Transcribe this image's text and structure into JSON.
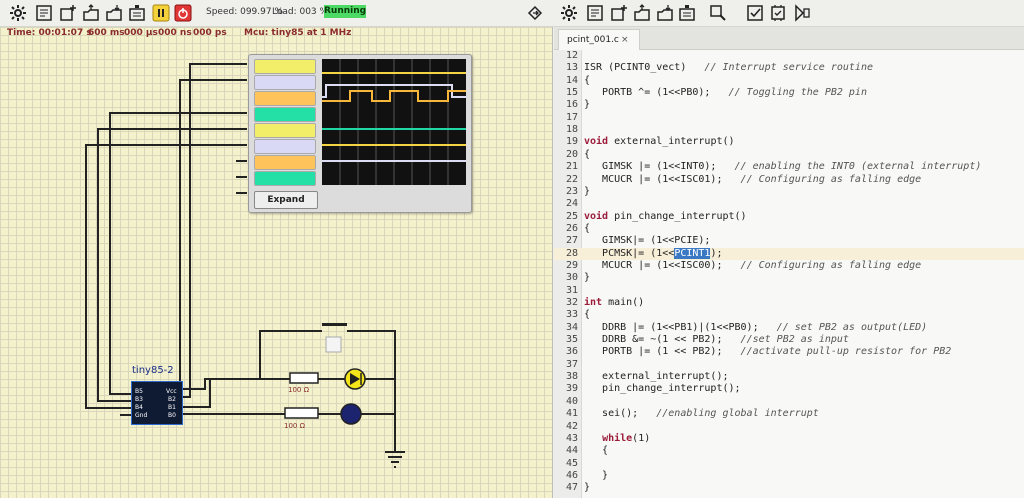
{
  "toolbar": {
    "left_icons": [
      "gear-icon",
      "list-check-icon",
      "new-file-icon",
      "open-file-icon",
      "upload-icon",
      "save-icon",
      "pause-icon",
      "power-icon"
    ],
    "speed": "Speed: 099.97 %",
    "load": "Load: 003 %",
    "status": "Running",
    "right_icons": [
      "diamond-arrow-icon",
      "gear-icon",
      "list-check-icon",
      "new-file-icon",
      "open-file-icon",
      "upload-icon",
      "save-icon",
      "search-icon",
      "checkbox-icon",
      "compile-icon",
      "debug-icon"
    ]
  },
  "status_bar": {
    "time": "Time: 00:01:07 s",
    "ms": "600 ms",
    "us": "000 µs",
    "ns": "000 ns",
    "ps": "000 ps",
    "mcu": "Mcu: tiny85 at 1 MHz"
  },
  "colors": {
    "running_bg": "#4cd964",
    "wire": "#222222",
    "trace_yellow": "#f4d442",
    "trace_white": "#dcdcf2",
    "trace_orange": "#f6b73c",
    "trace_green": "#1fd8a6"
  },
  "scope": {
    "channel_colors": [
      "#f2ee6a",
      "#d9d9f5",
      "#ffc35c",
      "#24e0a6",
      "#f2ee6a",
      "#d9d9f5",
      "#ffc35c",
      "#24e0a6"
    ],
    "expand_label": "Expand"
  },
  "circuit": {
    "chip_name": "tiny85-2",
    "pins_left": [
      "B5",
      "B3",
      "B4",
      "Gnd"
    ],
    "pins_right": [
      "Vcc",
      "B2",
      "B1",
      "B0"
    ],
    "resistor_labels": [
      "100 Ω",
      "100 Ω"
    ]
  },
  "editor": {
    "tab_name": "pcint_001.c",
    "tab_close": "×",
    "lines": [
      {
        "n": "12",
        "t": ""
      },
      {
        "n": "13",
        "t": "ISR (PCINT0_vect)",
        "c": "// Interrupt service routine"
      },
      {
        "n": "14",
        "t": "{"
      },
      {
        "n": "15",
        "t": "   PORTB ^= (1<<PB0);",
        "c": "// Toggling the PB2 pin"
      },
      {
        "n": "16",
        "t": "}"
      },
      {
        "n": "17",
        "t": ""
      },
      {
        "n": "18",
        "t": ""
      },
      {
        "n": "19",
        "k": "void",
        "t": " external_interrupt()"
      },
      {
        "n": "20",
        "t": "{"
      },
      {
        "n": "21",
        "t": "   GIMSK |= (1<<INT0);",
        "c": "// enabling the INT0 (external interrupt)"
      },
      {
        "n": "22",
        "t": "   MCUCR |= (1<<ISC01);",
        "c": "// Configuring as falling edge"
      },
      {
        "n": "23",
        "t": "}"
      },
      {
        "n": "24",
        "t": ""
      },
      {
        "n": "25",
        "k": "void",
        "t": " pin_change_interrupt()"
      },
      {
        "n": "26",
        "t": "{"
      },
      {
        "n": "27",
        "t": "   GIMSK|= (1<<PCIE);"
      },
      {
        "n": "28",
        "t": "   PCMSK|= (1<<",
        "h": "PCINT1",
        "t2": ");"
      },
      {
        "n": "29",
        "t": "   MCUCR |= (1<<ISC00);",
        "c": "// Configuring as falling edge"
      },
      {
        "n": "30",
        "t": "}"
      },
      {
        "n": "31",
        "t": ""
      },
      {
        "n": "32",
        "k": "int",
        "t": " main()"
      },
      {
        "n": "33",
        "t": "{"
      },
      {
        "n": "34",
        "t": "   DDRB |= (1<<PB1)|(1<<PB0);",
        "c": "// set PB2 as output(LED)"
      },
      {
        "n": "35",
        "t": "   DDRB &= ~(1 << PB2);",
        "c": "//set PB2 as input"
      },
      {
        "n": "36",
        "t": "   PORTB |= (1 << PB2);",
        "c": "//activate pull-up resistor for PB2"
      },
      {
        "n": "37",
        "t": ""
      },
      {
        "n": "38",
        "t": "   external_interrupt();"
      },
      {
        "n": "39",
        "t": "   pin_change_interrupt();"
      },
      {
        "n": "40",
        "t": ""
      },
      {
        "n": "41",
        "t": "   sei();",
        "c": "//enabling global interrupt"
      },
      {
        "n": "42",
        "t": ""
      },
      {
        "n": "43",
        "t": "   ",
        "k2": "while",
        "t2": "(1)"
      },
      {
        "n": "44",
        "t": "   {"
      },
      {
        "n": "45",
        "t": ""
      },
      {
        "n": "46",
        "t": "   }"
      },
      {
        "n": "47",
        "t": "}"
      }
    ]
  }
}
